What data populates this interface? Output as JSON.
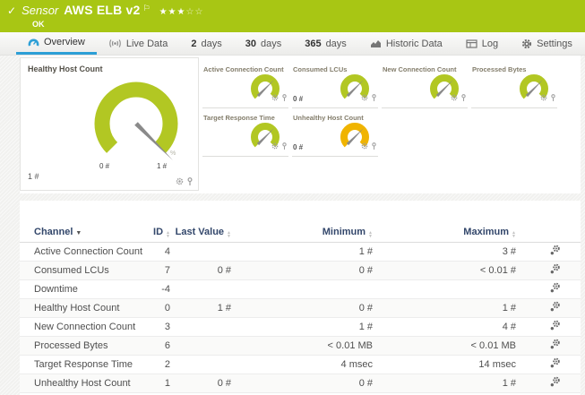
{
  "sensor_header": {
    "status_check": "✓",
    "kind_label": "Sensor",
    "name": "AWS ELB v2",
    "flag": "⚐",
    "stars_filled": "★★★",
    "stars_empty": "☆☆",
    "status_text": "OK",
    "bg_color": "#a8c614"
  },
  "tabs": {
    "active_color": "#2d9fd6",
    "items": [
      {
        "label": "Overview",
        "active": true
      },
      {
        "label": "Live Data"
      },
      {
        "num": "2",
        "label": "days"
      },
      {
        "num": "30",
        "label": "days"
      },
      {
        "num": "365",
        "label": "days"
      },
      {
        "label": "Historic Data"
      },
      {
        "label": "Log"
      },
      {
        "label": "Settings"
      }
    ]
  },
  "gauges": {
    "main": {
      "title": "Healthy Host Count",
      "value": "1 #",
      "scale_min": "0 #",
      "scale_max": "1 #",
      "unit_mark": "%",
      "color": "#b2c723"
    },
    "small": [
      {
        "title": "Active Connection Count",
        "value": "",
        "color": "#b2c723"
      },
      {
        "title": "Consumed LCUs",
        "value": "0 #",
        "color": "#b2c723"
      },
      {
        "title": "New Connection Count",
        "value": "",
        "color": "#b2c723"
      },
      {
        "title": "Processed Bytes",
        "value": "",
        "color": "#b2c723"
      },
      {
        "title": "Target Response Time",
        "value": "",
        "color": "#b2c723"
      },
      {
        "title": "Unhealthy Host Count",
        "value": "0 #",
        "color": "#f0b400"
      }
    ]
  },
  "table": {
    "sort_desc_glyph": "▼",
    "sort_idle_up": "▲",
    "sort_idle_down": "▼",
    "columns": [
      {
        "label": "Channel"
      },
      {
        "label": "ID"
      },
      {
        "label": "Last Value"
      },
      {
        "label": "Minimum"
      },
      {
        "label": "Maximum"
      }
    ],
    "rows": [
      {
        "channel": "Active Connection Count",
        "id": "4",
        "last": "",
        "min": "1 #",
        "max": "3 #"
      },
      {
        "channel": "Consumed LCUs",
        "id": "7",
        "last": "0 #",
        "min": "0 #",
        "max": "< 0.01 #"
      },
      {
        "channel": "Downtime",
        "id": "-4",
        "last": "",
        "min": "",
        "max": ""
      },
      {
        "channel": "Healthy Host Count",
        "id": "0",
        "last": "1 #",
        "min": "0 #",
        "max": "1 #"
      },
      {
        "channel": "New Connection Count",
        "id": "3",
        "last": "",
        "min": "1 #",
        "max": "4 #"
      },
      {
        "channel": "Processed Bytes",
        "id": "6",
        "last": "",
        "min": "< 0.01 MB",
        "max": "< 0.01 MB"
      },
      {
        "channel": "Target Response Time",
        "id": "2",
        "last": "",
        "min": "4 msec",
        "max": "14 msec"
      },
      {
        "channel": "Unhealthy Host Count",
        "id": "1",
        "last": "0 #",
        "min": "0 #",
        "max": "1 #"
      }
    ]
  }
}
